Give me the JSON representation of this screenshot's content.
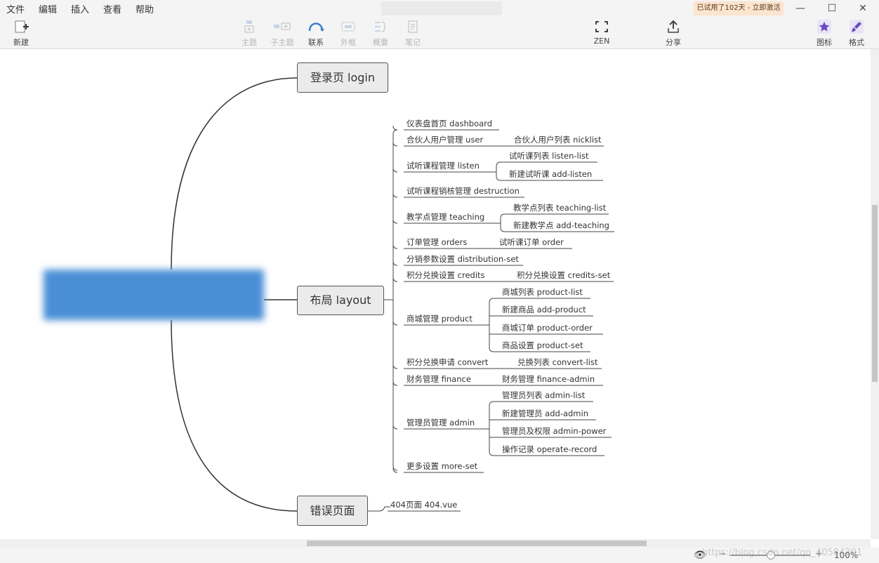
{
  "menu": [
    "文件",
    "编辑",
    "插入",
    "查看",
    "帮助"
  ],
  "trial_badge": "已试用了102天 - 立即激活",
  "window": {
    "minimize": "—",
    "maximize": "☐",
    "close": "✕"
  },
  "toolbar": {
    "new": "新建",
    "topic": "主题",
    "subtopic": "子主题",
    "relation": "联系",
    "boundary": "外框",
    "summary": "概要",
    "note": "笔记",
    "zen": "ZEN",
    "share": "分享",
    "icons": "图标",
    "format": "格式"
  },
  "map": {
    "main_topics": {
      "login": "登录页 login",
      "layout": "布局 layout",
      "error": "错误页面"
    },
    "layout_children": [
      "仪表盘首页 dashboard",
      "合伙人用户管理 user",
      "试听课程管理 listen",
      "试听课程销核管理 destruction",
      "教学点管理 teaching",
      "订单管理 orders",
      "分销参数设置 distribution-set",
      "积分兑换设置 credits",
      "商城管理 product",
      "积分兑换申请 convert",
      "财务管理 finance",
      "管理员管理 admin",
      "更多设置 more-set"
    ],
    "grandchildren": {
      "user": [
        "合伙人用户列表 nicklist"
      ],
      "listen": [
        "试听课列表 listen-list",
        "新建试听课 add-listen"
      ],
      "teaching": [
        "教学点列表 teaching-list",
        "新建教学点 add-teaching"
      ],
      "orders": [
        "试听课订单 order"
      ],
      "credits": [
        "积分兑换设置 credits-set"
      ],
      "product": [
        "商城列表 product-list",
        "新建商品 add-product",
        "商城订单 product-order",
        "商品设置 product-set"
      ],
      "convert": [
        "兑换列表 convert-list"
      ],
      "finance": [
        "财务管理 finance-admin"
      ],
      "admin": [
        "管理员列表 admin-list",
        "新建管理员 add-admin",
        "管理员及权限 admin-power",
        "操作记录 operate-record"
      ]
    },
    "error_children": [
      "404页面 404.vue"
    ]
  },
  "status": {
    "zoom": "100%",
    "zoom_minus": "−",
    "zoom_plus": "+",
    "watermark": "https://blog.csdn.net/qq_40584291"
  }
}
